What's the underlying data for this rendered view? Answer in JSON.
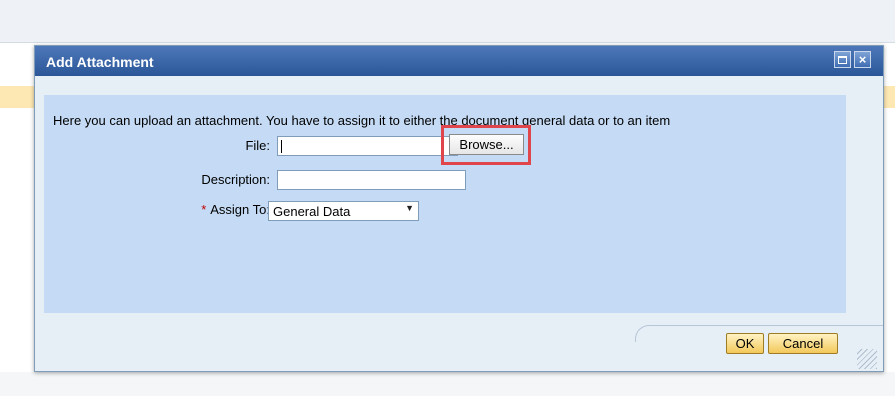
{
  "dialog": {
    "title": "Add Attachment",
    "intro": "Here you can upload an attachment. You have to assign it to either the document general data or to an item",
    "labels": {
      "file": "File:",
      "description": "Description:",
      "required_marker": "*",
      "assign_to": "Assign To:"
    },
    "file_value": "",
    "description_value": "",
    "browse_label": "Browse...",
    "assign_to_value": "General Data",
    "ok_label": "OK",
    "cancel_label": "Cancel"
  },
  "icons": {
    "maximize": "maximize-icon",
    "close": "close-icon",
    "dropdown": "chevron-down-icon"
  },
  "colors": {
    "titlebar": "#2b5799",
    "content_bg": "#c5dbf5",
    "highlight": "#e0454b",
    "ok_button": "#f3c85a"
  }
}
